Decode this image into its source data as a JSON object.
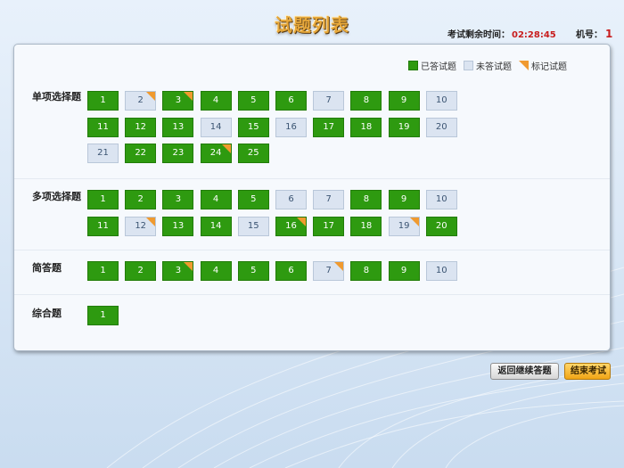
{
  "header": {
    "title": "试题列表",
    "timer_label": "考试剩余时间：",
    "timer_value": "02:28:45",
    "machine_label": "机号：",
    "machine_value": "1"
  },
  "legend": {
    "answered": "已答试题",
    "unanswered": "未答试题",
    "marked": "标记试题"
  },
  "colors": {
    "answered": "#2e9a10",
    "unanswered": "#dbe4f1",
    "marked": "#f09a2f",
    "timer": "#c81d1d"
  },
  "sections": [
    {
      "label": "单项选择题",
      "questions": [
        {
          "num": "1",
          "answered": true,
          "marked": false
        },
        {
          "num": "2",
          "answered": false,
          "marked": true
        },
        {
          "num": "3",
          "answered": true,
          "marked": true
        },
        {
          "num": "4",
          "answered": true,
          "marked": false
        },
        {
          "num": "5",
          "answered": true,
          "marked": false
        },
        {
          "num": "6",
          "answered": true,
          "marked": false
        },
        {
          "num": "7",
          "answered": false,
          "marked": false
        },
        {
          "num": "8",
          "answered": true,
          "marked": false
        },
        {
          "num": "9",
          "answered": true,
          "marked": false
        },
        {
          "num": "10",
          "answered": false,
          "marked": false
        },
        {
          "num": "11",
          "answered": true,
          "marked": false
        },
        {
          "num": "12",
          "answered": true,
          "marked": false
        },
        {
          "num": "13",
          "answered": true,
          "marked": false
        },
        {
          "num": "14",
          "answered": false,
          "marked": false
        },
        {
          "num": "15",
          "answered": true,
          "marked": false
        },
        {
          "num": "16",
          "answered": false,
          "marked": false
        },
        {
          "num": "17",
          "answered": true,
          "marked": false
        },
        {
          "num": "18",
          "answered": true,
          "marked": false
        },
        {
          "num": "19",
          "answered": true,
          "marked": false
        },
        {
          "num": "20",
          "answered": false,
          "marked": false
        },
        {
          "num": "21",
          "answered": false,
          "marked": false
        },
        {
          "num": "22",
          "answered": true,
          "marked": false
        },
        {
          "num": "23",
          "answered": true,
          "marked": false
        },
        {
          "num": "24",
          "answered": true,
          "marked": true
        },
        {
          "num": "25",
          "answered": true,
          "marked": false
        }
      ]
    },
    {
      "label": "多项选择题",
      "questions": [
        {
          "num": "1",
          "answered": true,
          "marked": false
        },
        {
          "num": "2",
          "answered": true,
          "marked": false
        },
        {
          "num": "3",
          "answered": true,
          "marked": false
        },
        {
          "num": "4",
          "answered": true,
          "marked": false
        },
        {
          "num": "5",
          "answered": true,
          "marked": false
        },
        {
          "num": "6",
          "answered": false,
          "marked": false
        },
        {
          "num": "7",
          "answered": false,
          "marked": false
        },
        {
          "num": "8",
          "answered": true,
          "marked": false
        },
        {
          "num": "9",
          "answered": true,
          "marked": false
        },
        {
          "num": "10",
          "answered": false,
          "marked": false
        },
        {
          "num": "11",
          "answered": true,
          "marked": false
        },
        {
          "num": "12",
          "answered": false,
          "marked": true
        },
        {
          "num": "13",
          "answered": true,
          "marked": false
        },
        {
          "num": "14",
          "answered": true,
          "marked": false
        },
        {
          "num": "15",
          "answered": false,
          "marked": false
        },
        {
          "num": "16",
          "answered": true,
          "marked": true
        },
        {
          "num": "17",
          "answered": true,
          "marked": false
        },
        {
          "num": "18",
          "answered": true,
          "marked": false
        },
        {
          "num": "19",
          "answered": false,
          "marked": true
        },
        {
          "num": "20",
          "answered": true,
          "marked": false
        }
      ]
    },
    {
      "label": "简答题",
      "questions": [
        {
          "num": "1",
          "answered": true,
          "marked": false
        },
        {
          "num": "2",
          "answered": true,
          "marked": false
        },
        {
          "num": "3",
          "answered": true,
          "marked": true
        },
        {
          "num": "4",
          "answered": true,
          "marked": false
        },
        {
          "num": "5",
          "answered": true,
          "marked": false
        },
        {
          "num": "6",
          "answered": true,
          "marked": false
        },
        {
          "num": "7",
          "answered": false,
          "marked": true
        },
        {
          "num": "8",
          "answered": true,
          "marked": false
        },
        {
          "num": "9",
          "answered": true,
          "marked": false
        },
        {
          "num": "10",
          "answered": false,
          "marked": false
        }
      ]
    },
    {
      "label": "综合题",
      "questions": [
        {
          "num": "1",
          "answered": true,
          "marked": false
        }
      ]
    }
  ],
  "buttons": {
    "back": "返回继续答题",
    "end": "结束考试"
  }
}
